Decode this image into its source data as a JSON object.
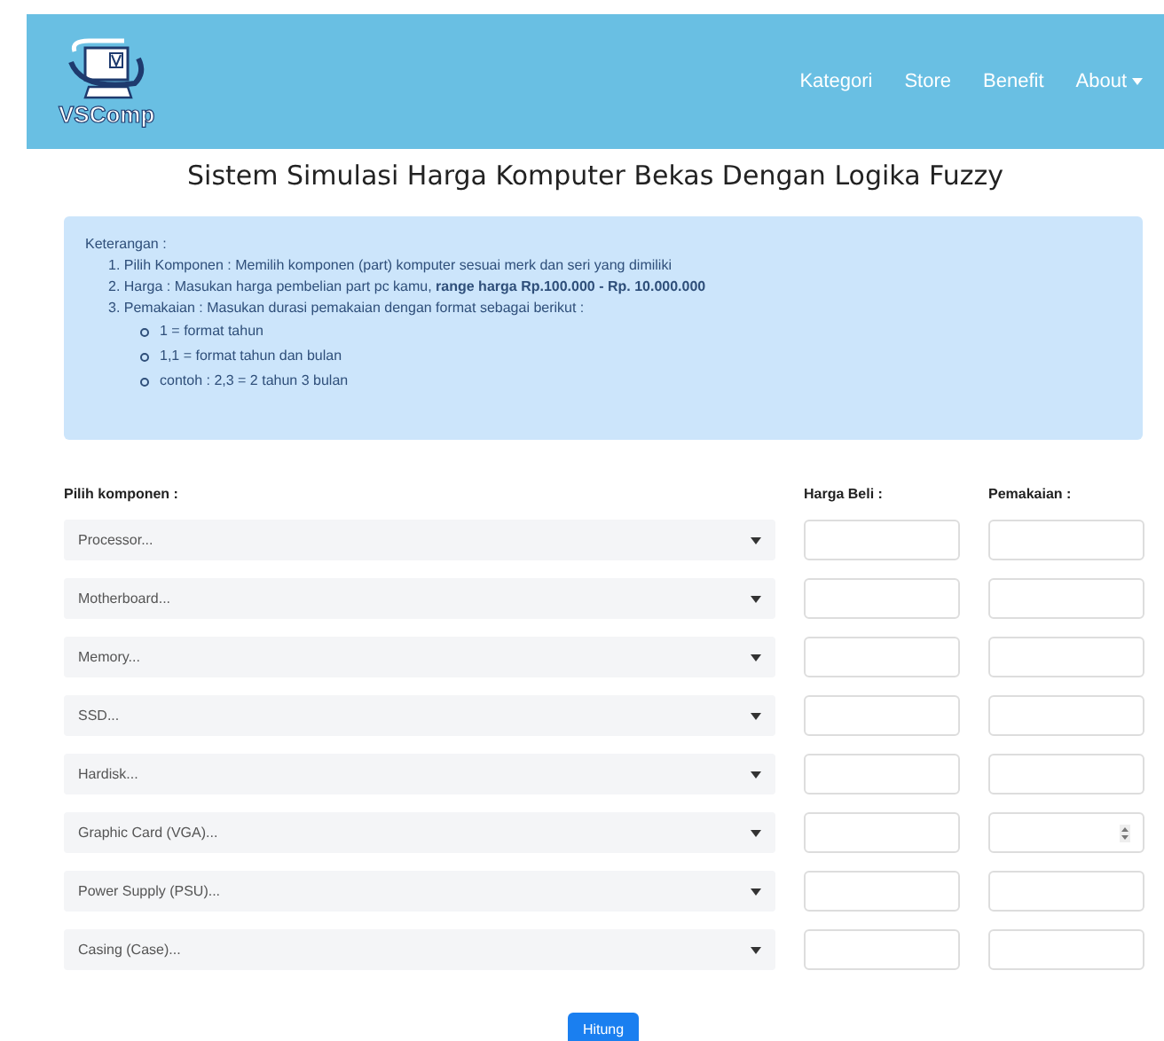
{
  "navbar": {
    "brand": "VSComp",
    "links": [
      {
        "label": "Kategori",
        "dropdown": false
      },
      {
        "label": "Store",
        "dropdown": false
      },
      {
        "label": "Benefit",
        "dropdown": false
      },
      {
        "label": "About",
        "dropdown": true
      }
    ]
  },
  "title": "Sistem Simulasi Harga Komputer Bekas Dengan Logika Fuzzy",
  "info": {
    "heading": "Keterangan :",
    "items": [
      {
        "text": "1. Pilih Komponen : Memilih komponen (part) komputer sesuai merk dan seri yang dimiliki"
      },
      {
        "text": "2. Harga : Masukan harga pembelian part pc kamu, **range harga Rp.100.000 - Rp. 10.000.000**"
      },
      {
        "text": "3. Pemakaian : Masukan durasi pemakaian dengan format sebagai berikut :",
        "children": [
          "1 = format tahun",
          "1,1 = format tahun dan bulan",
          "contoh : 2,3 = 2 tahun 3 bulan"
        ]
      }
    ]
  },
  "form": {
    "columns": [
      "Pilih komponen :",
      "Harga Beli :",
      "Pemakaian :"
    ],
    "rows": [
      {
        "placeholder": "Processor...",
        "spinner": false
      },
      {
        "placeholder": "Motherboard...",
        "spinner": false
      },
      {
        "placeholder": "Memory...",
        "spinner": false
      },
      {
        "placeholder": "SSD...",
        "spinner": false
      },
      {
        "placeholder": "Hardisk...",
        "spinner": false
      },
      {
        "placeholder": "Graphic Card (VGA)...",
        "spinner": true
      },
      {
        "placeholder": "Power Supply (PSU)...",
        "spinner": false
      },
      {
        "placeholder": "Casing (Case)...",
        "spinner": false
      }
    ],
    "submit": "Hitung"
  }
}
